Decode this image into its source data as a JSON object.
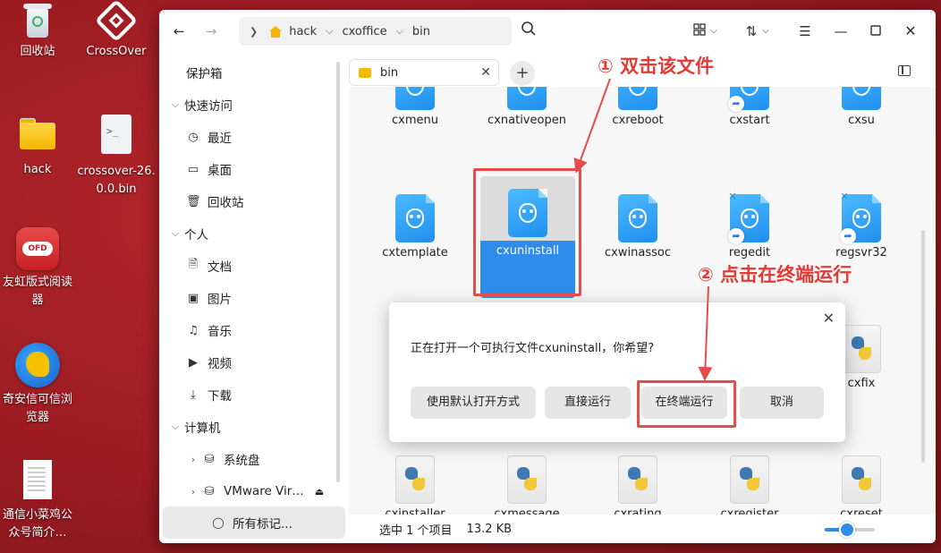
{
  "desktop": {
    "icons": [
      {
        "label": "回收站",
        "icon": "trash-icon"
      },
      {
        "label": "CrossOver",
        "icon": "crossover-icon"
      },
      {
        "label": "hack",
        "icon": "folder-icon"
      },
      {
        "label": "crossover-26.0.0.bin",
        "icon": "script-file-icon"
      },
      {
        "label": "友虹版式阅读器",
        "icon": "ofd-reader-icon"
      },
      {
        "label": "奇安信可信浏览器",
        "icon": "browser-icon"
      },
      {
        "label": "通信小菜鸡公众号简介…",
        "icon": "document-icon"
      }
    ]
  },
  "window": {
    "breadcrumb": [
      "hack",
      "cxoffice",
      "bin"
    ],
    "tab": {
      "label": "bin"
    }
  },
  "sidebar": {
    "items": [
      {
        "label": "保护箱",
        "icon": ""
      },
      {
        "label": "快速访问",
        "icon": "chevron-down-icon"
      },
      {
        "label": "最近",
        "icon": "clock-icon"
      },
      {
        "label": "桌面",
        "icon": "monitor-icon"
      },
      {
        "label": "回收站",
        "icon": "trash-icon"
      },
      {
        "label": "个人",
        "icon": "chevron-down-icon"
      },
      {
        "label": "文档",
        "icon": "document-icon"
      },
      {
        "label": "图片",
        "icon": "image-icon"
      },
      {
        "label": "音乐",
        "icon": "music-icon"
      },
      {
        "label": "视频",
        "icon": "video-icon"
      },
      {
        "label": "下载",
        "icon": "download-icon"
      },
      {
        "label": "计算机",
        "icon": "chevron-down-icon"
      },
      {
        "label": "系统盘",
        "icon": "drive-icon"
      },
      {
        "label": "VMware Vir…",
        "icon": "drive-icon"
      },
      {
        "label": "所有标记...",
        "icon": "tag-icon"
      }
    ]
  },
  "files": [
    {
      "name": "cxmenu",
      "type": "exe"
    },
    {
      "name": "cxnativeopen",
      "type": "exe"
    },
    {
      "name": "cxreboot",
      "type": "exe"
    },
    {
      "name": "cxstart",
      "type": "exe-link"
    },
    {
      "name": "cxsu",
      "type": "exe"
    },
    {
      "name": "cxtemplate",
      "type": "exe"
    },
    {
      "name": "cxuninstall",
      "type": "exe",
      "selected": true
    },
    {
      "name": "cxwinassoc",
      "type": "exe"
    },
    {
      "name": "regedit",
      "type": "exe-link"
    },
    {
      "name": "regsvr32",
      "type": "exe-link"
    },
    {
      "name": "cxfix",
      "type": "python"
    },
    {
      "name": "cxinstaller",
      "type": "python"
    },
    {
      "name": "cxmessage",
      "type": "python"
    },
    {
      "name": "cxrating",
      "type": "python"
    },
    {
      "name": "cxregister",
      "type": "python"
    },
    {
      "name": "cxreset",
      "type": "python"
    }
  ],
  "status": {
    "selection": "选中 1 个项目",
    "size": "13.2 KB",
    "zoom_fraction": 0.45
  },
  "dialog": {
    "message": "正在打开一个可执行文件cxuninstall，你希望?",
    "buttons": [
      "使用默认打开方式",
      "直接运行",
      "在终端运行",
      "取消"
    ]
  },
  "annotations": {
    "step1": "① 双击该文件",
    "step2": "② 点击在终端运行",
    "color": "#e53935"
  },
  "colors": {
    "accent": "#2f8ceb",
    "desktop": "#9b1c22",
    "folder": "#f5b800"
  }
}
